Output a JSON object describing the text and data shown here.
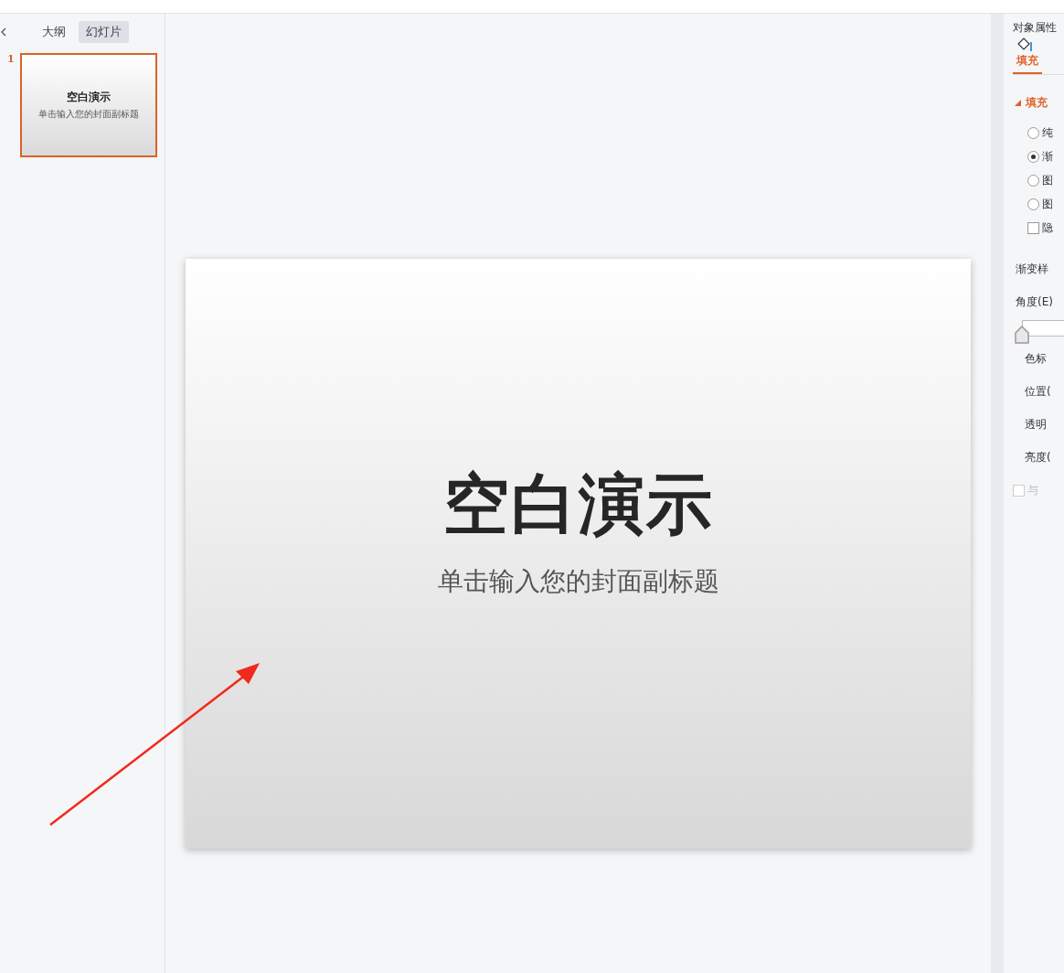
{
  "left_panel": {
    "tabs": [
      {
        "label": "大纲",
        "selected": false
      },
      {
        "label": "幻灯片",
        "selected": true
      }
    ],
    "slides": [
      {
        "number": "1",
        "title": "空白演示",
        "subtitle": "单击输入您的封面副标题",
        "selected": true
      }
    ]
  },
  "slide": {
    "title": "空白演示",
    "subtitle": "单击输入您的封面副标题"
  },
  "annotation": {
    "kind": "arrow"
  },
  "properties": {
    "title": "对象属性",
    "tabs": [
      {
        "label": "填充",
        "selected": true
      }
    ],
    "section": {
      "label": "填充",
      "expanded": true
    },
    "options": [
      {
        "kind": "radio",
        "label": "纯",
        "selected": false
      },
      {
        "kind": "radio",
        "label": "渐",
        "selected": true
      },
      {
        "kind": "radio",
        "label": "图",
        "selected": false
      },
      {
        "kind": "radio",
        "label": "图",
        "selected": false
      },
      {
        "kind": "checkbox",
        "label": "隐",
        "checked": false
      }
    ],
    "fields": [
      {
        "kind": "label",
        "label": "渐变样"
      },
      {
        "kind": "label",
        "label": "角度(E)"
      },
      {
        "kind": "slider",
        "level": 0
      },
      {
        "kind": "sublabel",
        "label": "色标"
      },
      {
        "kind": "sublabel",
        "label": "位置("
      },
      {
        "kind": "sublabel",
        "label": "透明"
      },
      {
        "kind": "sublabel",
        "label": "亮度("
      },
      {
        "kind": "checkbox",
        "label": "与",
        "checked": false,
        "disabled": true
      }
    ]
  }
}
